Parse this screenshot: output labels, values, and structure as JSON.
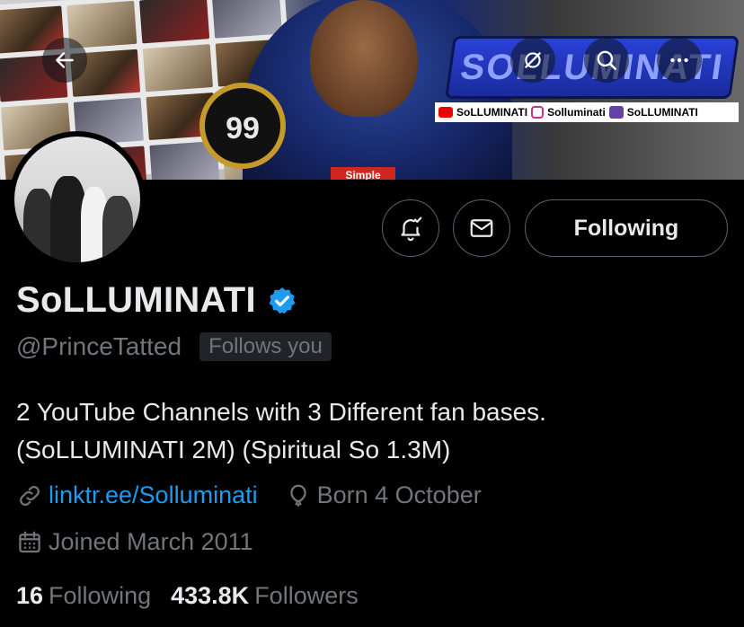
{
  "banner": {
    "badge_number": "99",
    "tag_text": "Simple",
    "logo_text": "SOLLUMINATI",
    "social": {
      "youtube_label": "SoLLUMINATI",
      "instagram_label": "Solluminati",
      "twitch_label": "SoLLUMINATI"
    }
  },
  "top_actions": {
    "back": "back-arrow-icon",
    "grok": "grok-icon",
    "search": "search-icon",
    "more": "more-icon"
  },
  "actions": {
    "notify_icon": "bell-add-icon",
    "message_icon": "mail-icon",
    "follow_label": "Following"
  },
  "profile": {
    "display_name": "SoLLUMINATI",
    "verified": true,
    "handle": "@PrinceTatted",
    "follows_you": "Follows you",
    "bio_line1": "2 YouTube Channels with 3 Different fan bases.",
    "bio_line2": "(SoLLUMINATI 2M) (Spiritual So 1.3M)",
    "link": "linktr.ee/Solluminati",
    "birthday": "Born 4 October",
    "joined": "Joined March 2011"
  },
  "stats": {
    "following_count": "16",
    "following_label": "Following",
    "followers_count": "433.8K",
    "followers_label": "Followers"
  },
  "colors": {
    "background": "#000000",
    "primary_text": "#e7e9ea",
    "secondary_text": "#71767b",
    "link": "#1d9bf0",
    "verified": "#1d9bf0",
    "border": "#536471"
  }
}
